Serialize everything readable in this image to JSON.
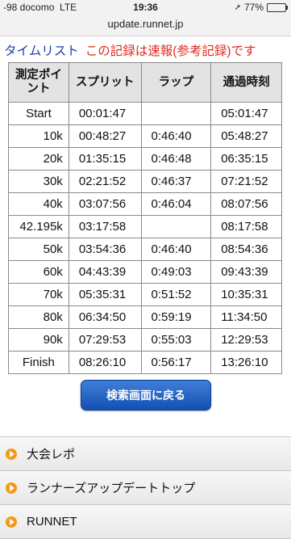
{
  "status": {
    "carrier": "-98 docomo",
    "network": "LTE",
    "time": "19:36",
    "battery": "77%"
  },
  "browser": {
    "url": "update.runnet.jp"
  },
  "heading": {
    "title": "タイムリスト",
    "note": "この記録は速報(参考記録)です"
  },
  "table": {
    "headers": [
      "測定ポイント",
      "スプリット",
      "ラップ",
      "通過時刻"
    ],
    "rows": [
      {
        "point": "Start",
        "split": "00:01:47",
        "lap": "",
        "time": "05:01:47"
      },
      {
        "point": "10k",
        "split": "00:48:27",
        "lap": "0:46:40",
        "time": "05:48:27"
      },
      {
        "point": "20k",
        "split": "01:35:15",
        "lap": "0:46:48",
        "time": "06:35:15"
      },
      {
        "point": "30k",
        "split": "02:21:52",
        "lap": "0:46:37",
        "time": "07:21:52"
      },
      {
        "point": "40k",
        "split": "03:07:56",
        "lap": "0:46:04",
        "time": "08:07:56"
      },
      {
        "point": "42.195k",
        "split": "03:17:58",
        "lap": "",
        "time": "08:17:58"
      },
      {
        "point": "50k",
        "split": "03:54:36",
        "lap": "0:46:40",
        "time": "08:54:36"
      },
      {
        "point": "60k",
        "split": "04:43:39",
        "lap": "0:49:03",
        "time": "09:43:39"
      },
      {
        "point": "70k",
        "split": "05:35:31",
        "lap": "0:51:52",
        "time": "10:35:31"
      },
      {
        "point": "80k",
        "split": "06:34:50",
        "lap": "0:59:19",
        "time": "11:34:50"
      },
      {
        "point": "90k",
        "split": "07:29:53",
        "lap": "0:55:03",
        "time": "12:29:53"
      },
      {
        "point": "Finish",
        "split": "08:26:10",
        "lap": "0:56:17",
        "time": "13:26:10"
      }
    ]
  },
  "button": {
    "label": "検索画面に戻る"
  },
  "menu": {
    "items": [
      "大会レポ",
      "ランナーズアップデートトップ",
      "RUNNET"
    ]
  }
}
